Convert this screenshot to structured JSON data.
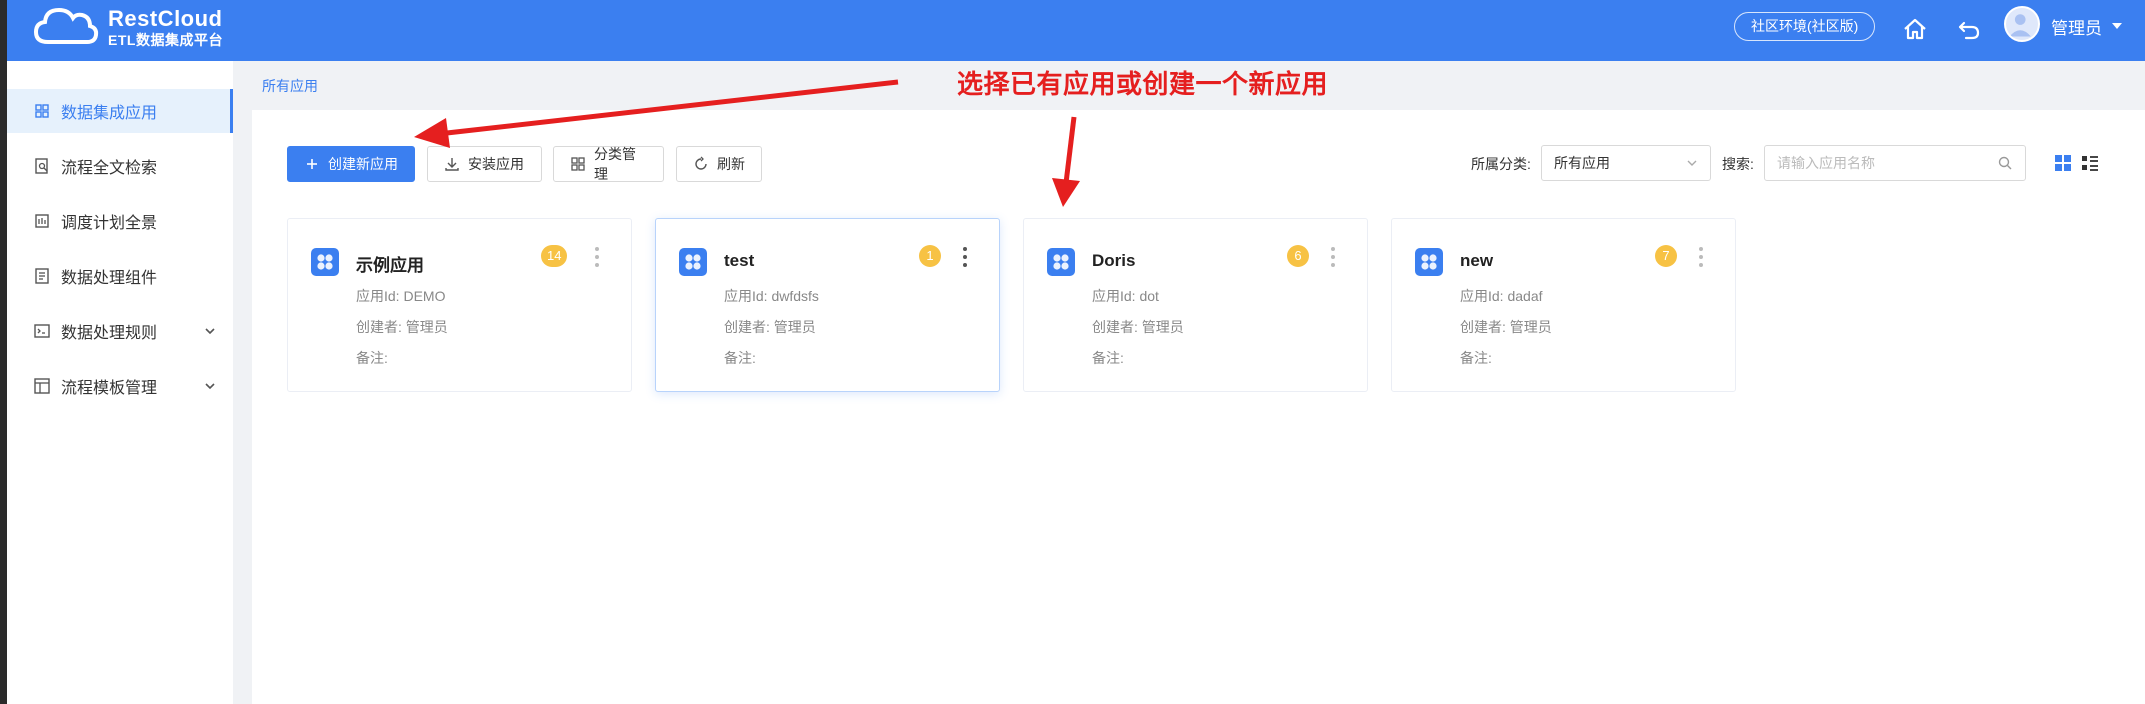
{
  "brand": {
    "name": "RestCloud",
    "subtitle": "ETL数据集成平台"
  },
  "topbar": {
    "env_label": "社区环境(社区版)",
    "user_name": "管理员",
    "icons": [
      "home-icon",
      "undo-icon",
      "user-avatar-icon"
    ]
  },
  "sidebar": {
    "items": [
      {
        "label": "数据集成应用",
        "icon": "grid-icon",
        "active": true
      },
      {
        "label": "流程全文检索",
        "icon": "doc-search-icon"
      },
      {
        "label": "调度计划全景",
        "icon": "schedule-icon"
      },
      {
        "label": "数据处理组件",
        "icon": "component-icon"
      },
      {
        "label": "数据处理规则",
        "icon": "terminal-icon",
        "expandable": true
      },
      {
        "label": "流程模板管理",
        "icon": "template-icon",
        "expandable": true
      }
    ]
  },
  "breadcrumb": {
    "current": "所有应用"
  },
  "toolbar": {
    "create_label": "创建新应用",
    "install_label": "安装应用",
    "category_label": "分类管理",
    "refresh_label": "刷新",
    "category_filter_label": "所属分类:",
    "category_filter_value": "所有应用",
    "search_label": "搜索:",
    "search_placeholder": "请输入应用名称",
    "views": [
      "grid-view-icon",
      "list-view-icon"
    ]
  },
  "cards": [
    {
      "title": "示例应用",
      "badge": "14",
      "app_id": "应用Id: DEMO",
      "creator": "创建者: 管理员",
      "note": "备注:"
    },
    {
      "title": "test",
      "badge": "1",
      "app_id": "应用Id: dwfdsfs",
      "creator": "创建者: 管理员",
      "note": "备注:"
    },
    {
      "title": "Doris",
      "badge": "6",
      "app_id": "应用Id: dot",
      "creator": "创建者: 管理员",
      "note": "备注:"
    },
    {
      "title": "new",
      "badge": "7",
      "app_id": "应用Id: dadaf",
      "creator": "创建者: 管理员",
      "note": "备注:"
    }
  ],
  "annotation": {
    "text": "选择已有应用或创建一个新应用"
  },
  "colors": {
    "primary": "#3b7ff0",
    "badge": "#f7c244",
    "annotation": "#e51f1f"
  }
}
